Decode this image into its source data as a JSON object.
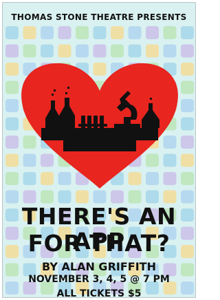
{
  "poster": {
    "presenter": "THOMAS STONE THEATRE PRESENTS",
    "title_line1": "THERE'S AN APP",
    "title_line2": "FOR THAT?",
    "byline": "BY ALAN GRIFFITH",
    "dates": "NOVEMBER 3, 4, 5 @ 7 PM",
    "tickets": "ALL TICKETS $5"
  },
  "colors": {
    "heart": "#e8251f",
    "silhouette": "#111111",
    "background": "#d9f1f0"
  },
  "icons": {
    "heart": "heart-icon",
    "lab": "science-lab-icon",
    "background_tiles": "app-icon-grid"
  }
}
